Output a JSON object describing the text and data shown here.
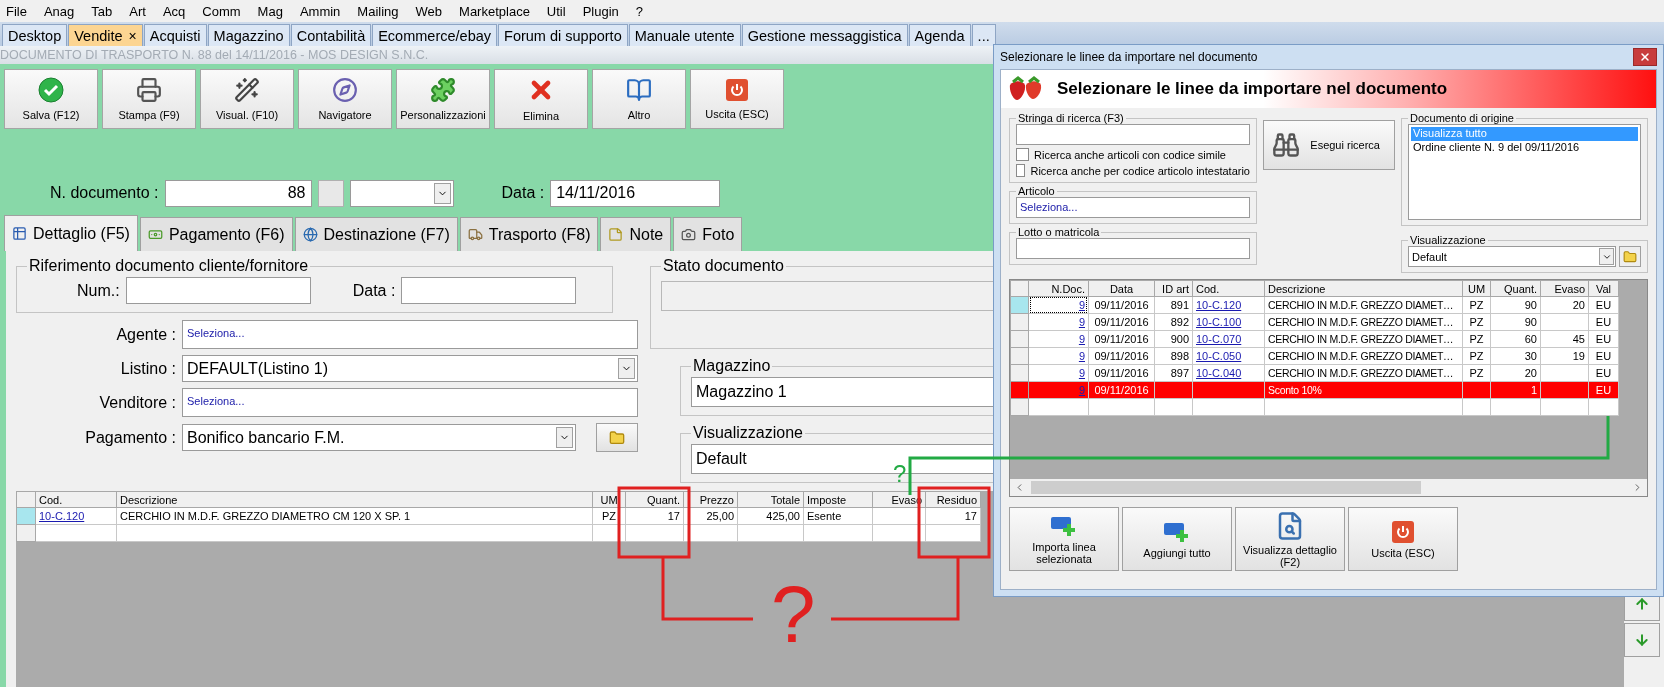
{
  "menu": [
    "File",
    "Anag",
    "Tab",
    "Art",
    "Acq",
    "Comm",
    "Mag",
    "Ammin",
    "Mailing",
    "Web",
    "Marketplace",
    "Util",
    "Plugin",
    "?"
  ],
  "app_tabs": [
    {
      "label": "Desktop",
      "selected": false
    },
    {
      "label": "Vendite",
      "selected": true,
      "close": "×"
    },
    {
      "label": "Acquisti",
      "selected": false
    },
    {
      "label": "Magazzino",
      "selected": false
    },
    {
      "label": "Contabilità",
      "selected": false
    },
    {
      "label": "Ecommerce/ebay",
      "selected": false
    },
    {
      "label": "Forum di supporto",
      "selected": false
    },
    {
      "label": "Manuale utente",
      "selected": false
    },
    {
      "label": "Gestione messaggistica",
      "selected": false
    },
    {
      "label": "Agenda",
      "selected": false
    },
    {
      "label": "...",
      "selected": false
    }
  ],
  "document_title": "DOCUMENTO DI TRASPORTO N. 88 del 14/11/2016 - MOS DESIGN S.N.C.",
  "toolbar": [
    {
      "kind": "save",
      "label": "Salva (F12)"
    },
    {
      "kind": "print",
      "label": "Stampa (F9)"
    },
    {
      "kind": "view",
      "label": "Visual. (F10)"
    },
    {
      "kind": "navigator",
      "label": "Navigatore"
    },
    {
      "kind": "customize",
      "label": "Personalizzazioni"
    },
    {
      "kind": "delete",
      "label": "Elimina"
    },
    {
      "kind": "more",
      "label": "Altro"
    },
    {
      "kind": "exit",
      "label": "Uscita (ESC)"
    }
  ],
  "header": {
    "number_label": "N. documento :",
    "number": "88",
    "date_label": "Data :",
    "date": "14/11/2016"
  },
  "form_tabs": [
    {
      "kind": "detail",
      "label": "Dettaglio (F5)",
      "selected": true
    },
    {
      "kind": "payment",
      "label": "Pagamento (F6)",
      "selected": false
    },
    {
      "kind": "destination",
      "label": "Destinazione (F7)",
      "selected": false
    },
    {
      "kind": "transport",
      "label": "Trasporto (F8)",
      "selected": false
    },
    {
      "kind": "notes",
      "label": "Note",
      "selected": false
    },
    {
      "kind": "photo",
      "label": "Foto",
      "selected": false
    }
  ],
  "reference": {
    "title": "Riferimento documento cliente/fornitore",
    "number_label": "Num.:",
    "date_label": "Data :"
  },
  "fields": [
    {
      "kind": "lookup",
      "label": "Agente :",
      "value": "Seleziona..."
    },
    {
      "kind": "combo",
      "label": "Listino :",
      "value": "DEFAULT(Listino 1)"
    },
    {
      "kind": "lookup",
      "label": "Venditore :",
      "value": "Seleziona..."
    },
    {
      "kind": "combo_folder",
      "label": "Pagamento :",
      "value": "Bonifico bancario F.M."
    }
  ],
  "status": {
    "title": "Stato documento"
  },
  "warehouse": {
    "title": "Magazzino",
    "value": "Magazzino 1"
  },
  "view": {
    "title": "Visualizzazione",
    "value": "Default"
  },
  "lines": {
    "columns": [
      {
        "label": "Cod.",
        "kind": "link"
      },
      {
        "label": "Descrizione",
        "kind": "text"
      },
      {
        "label": "UM",
        "kind": "center"
      },
      {
        "label": "Quant.",
        "kind": "number"
      },
      {
        "label": "Prezzo",
        "kind": "number"
      },
      {
        "label": "Totale",
        "kind": "number"
      },
      {
        "label": "Imposte",
        "kind": "text"
      },
      {
        "label": "Evaso",
        "kind": "number"
      },
      {
        "label": "Residuo",
        "kind": "number"
      }
    ],
    "rows": [
      {
        "selected": true,
        "cells": [
          "10-C.120",
          "CERCHIO IN M.D.F. GREZZO DIAMETRO CM 120 X SP. 1",
          "PZ",
          "17",
          "25,00",
          "425,00",
          "Esente",
          null,
          "17"
        ]
      }
    ]
  },
  "dialog": {
    "title": "Selezionare le linee da importare nel documento",
    "heading": "Selezionare le linee da importare nel documento",
    "search": {
      "title": "Stringa di ricerca (F3)",
      "options": [
        {
          "label": "Ricerca anche articoli con codice simile",
          "checked": false
        },
        {
          "label": "Ricerca anche per codice articolo intestatario",
          "checked": false
        }
      ]
    },
    "search_button": "Esegui ricerca",
    "article": {
      "title": "Articolo",
      "value": "Seleziona..."
    },
    "lot": {
      "title": "Lotto o matricola"
    },
    "origin": {
      "title": "Documento di origine",
      "items": [
        {
          "label": "Visualizza tutto",
          "selected": true
        },
        {
          "label": "Ordine cliente N. 9 del 09/11/2016",
          "selected": false
        }
      ]
    },
    "view": {
      "title": "Visualizzazione",
      "value": "Default"
    },
    "table": {
      "columns": [
        {
          "label": "N.Doc.",
          "kind": "link_number"
        },
        {
          "label": "Data",
          "kind": "center"
        },
        {
          "label": "ID art",
          "kind": "number"
        },
        {
          "label": "Cod.",
          "kind": "link"
        },
        {
          "label": "Descrizione",
          "kind": "text"
        },
        {
          "label": "UM",
          "kind": "center"
        },
        {
          "label": "Quant.",
          "kind": "number"
        },
        {
          "label": "Evaso",
          "kind": "number"
        },
        {
          "label": "Val",
          "kind": "center"
        }
      ],
      "rows": [
        {
          "selected": true,
          "highlight": false,
          "cells": [
            "9",
            "09/11/2016",
            "891",
            "10-C.120",
            "CERCHIO IN M.D.F. GREZZO DIAMET…",
            "PZ",
            "90",
            "20",
            "EU"
          ]
        },
        {
          "selected": false,
          "highlight": false,
          "cells": [
            "9",
            "09/11/2016",
            "892",
            "10-C.100",
            "CERCHIO IN M.D.F. GREZZO DIAMET…",
            "PZ",
            "90",
            null,
            "EU"
          ]
        },
        {
          "selected": false,
          "highlight": false,
          "cells": [
            "9",
            "09/11/2016",
            "900",
            "10-C.070",
            "CERCHIO IN M.D.F. GREZZO DIAMET…",
            "PZ",
            "60",
            "45",
            "EU"
          ]
        },
        {
          "selected": false,
          "highlight": false,
          "cells": [
            "9",
            "09/11/2016",
            "898",
            "10-C.050",
            "CERCHIO IN M.D.F. GREZZO DIAMET…",
            "PZ",
            "30",
            "19",
            "EU"
          ]
        },
        {
          "selected": false,
          "highlight": false,
          "cells": [
            "9",
            "09/11/2016",
            "897",
            "10-C.040",
            "CERCHIO IN M.D.F. GREZZO DIAMET…",
            "PZ",
            "20",
            null,
            "EU"
          ]
        },
        {
          "selected": false,
          "highlight": true,
          "cells": [
            "9",
            "09/11/2016",
            null,
            null,
            "Sconto 10%",
            null,
            "1",
            null,
            "EU"
          ]
        }
      ]
    },
    "buttons": [
      {
        "kind": "import",
        "label": "Importa linea selezionata"
      },
      {
        "kind": "add_all",
        "label": "Aggiungi tutto"
      },
      {
        "kind": "detail",
        "label": "Visualizza dettaglio (F2)"
      },
      {
        "kind": "exit",
        "label": "Uscita (ESC)"
      }
    ]
  },
  "annotations": {
    "green": "?",
    "red": "?"
  }
}
